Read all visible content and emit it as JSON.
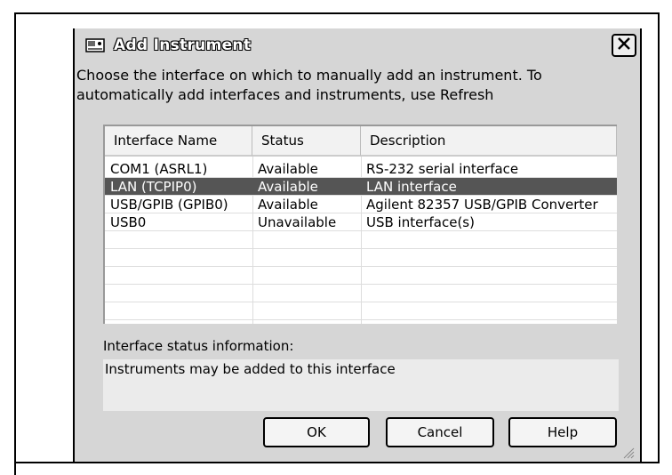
{
  "dialog": {
    "title": "Add Instrument",
    "instructions_line1": "Choose the interface on which to manually add an instrument.  To",
    "instructions_line2": "automatically add interfaces and instruments, use Refresh"
  },
  "table": {
    "headers": [
      "Interface Name",
      "Status",
      "Description"
    ],
    "rows": [
      {
        "name": "COM1 (ASRL1)",
        "status": "Available",
        "description": "RS-232 serial interface"
      },
      {
        "name": "LAN (TCPIP0)",
        "status": "Available",
        "description": "LAN interface",
        "selected": true
      },
      {
        "name": "USB/GPIB (GPIB0)",
        "status": "Available",
        "description": "Agilent 82357 USB/GPIB Converter"
      },
      {
        "name": "USB0",
        "status": "Unavailable",
        "description": "USB interface(s)"
      }
    ]
  },
  "status_info": {
    "label": "Interface status information:",
    "text": "Instruments may be added to this interface"
  },
  "buttons": {
    "ok": "OK",
    "cancel": "Cancel",
    "help": "Help"
  },
  "icons": {
    "app": "instrument-icon",
    "close": "close-icon",
    "resize": "resize-grip-icon"
  },
  "colors": {
    "selected_row": "#555555",
    "dialog_bg": "#d6d6d6"
  }
}
